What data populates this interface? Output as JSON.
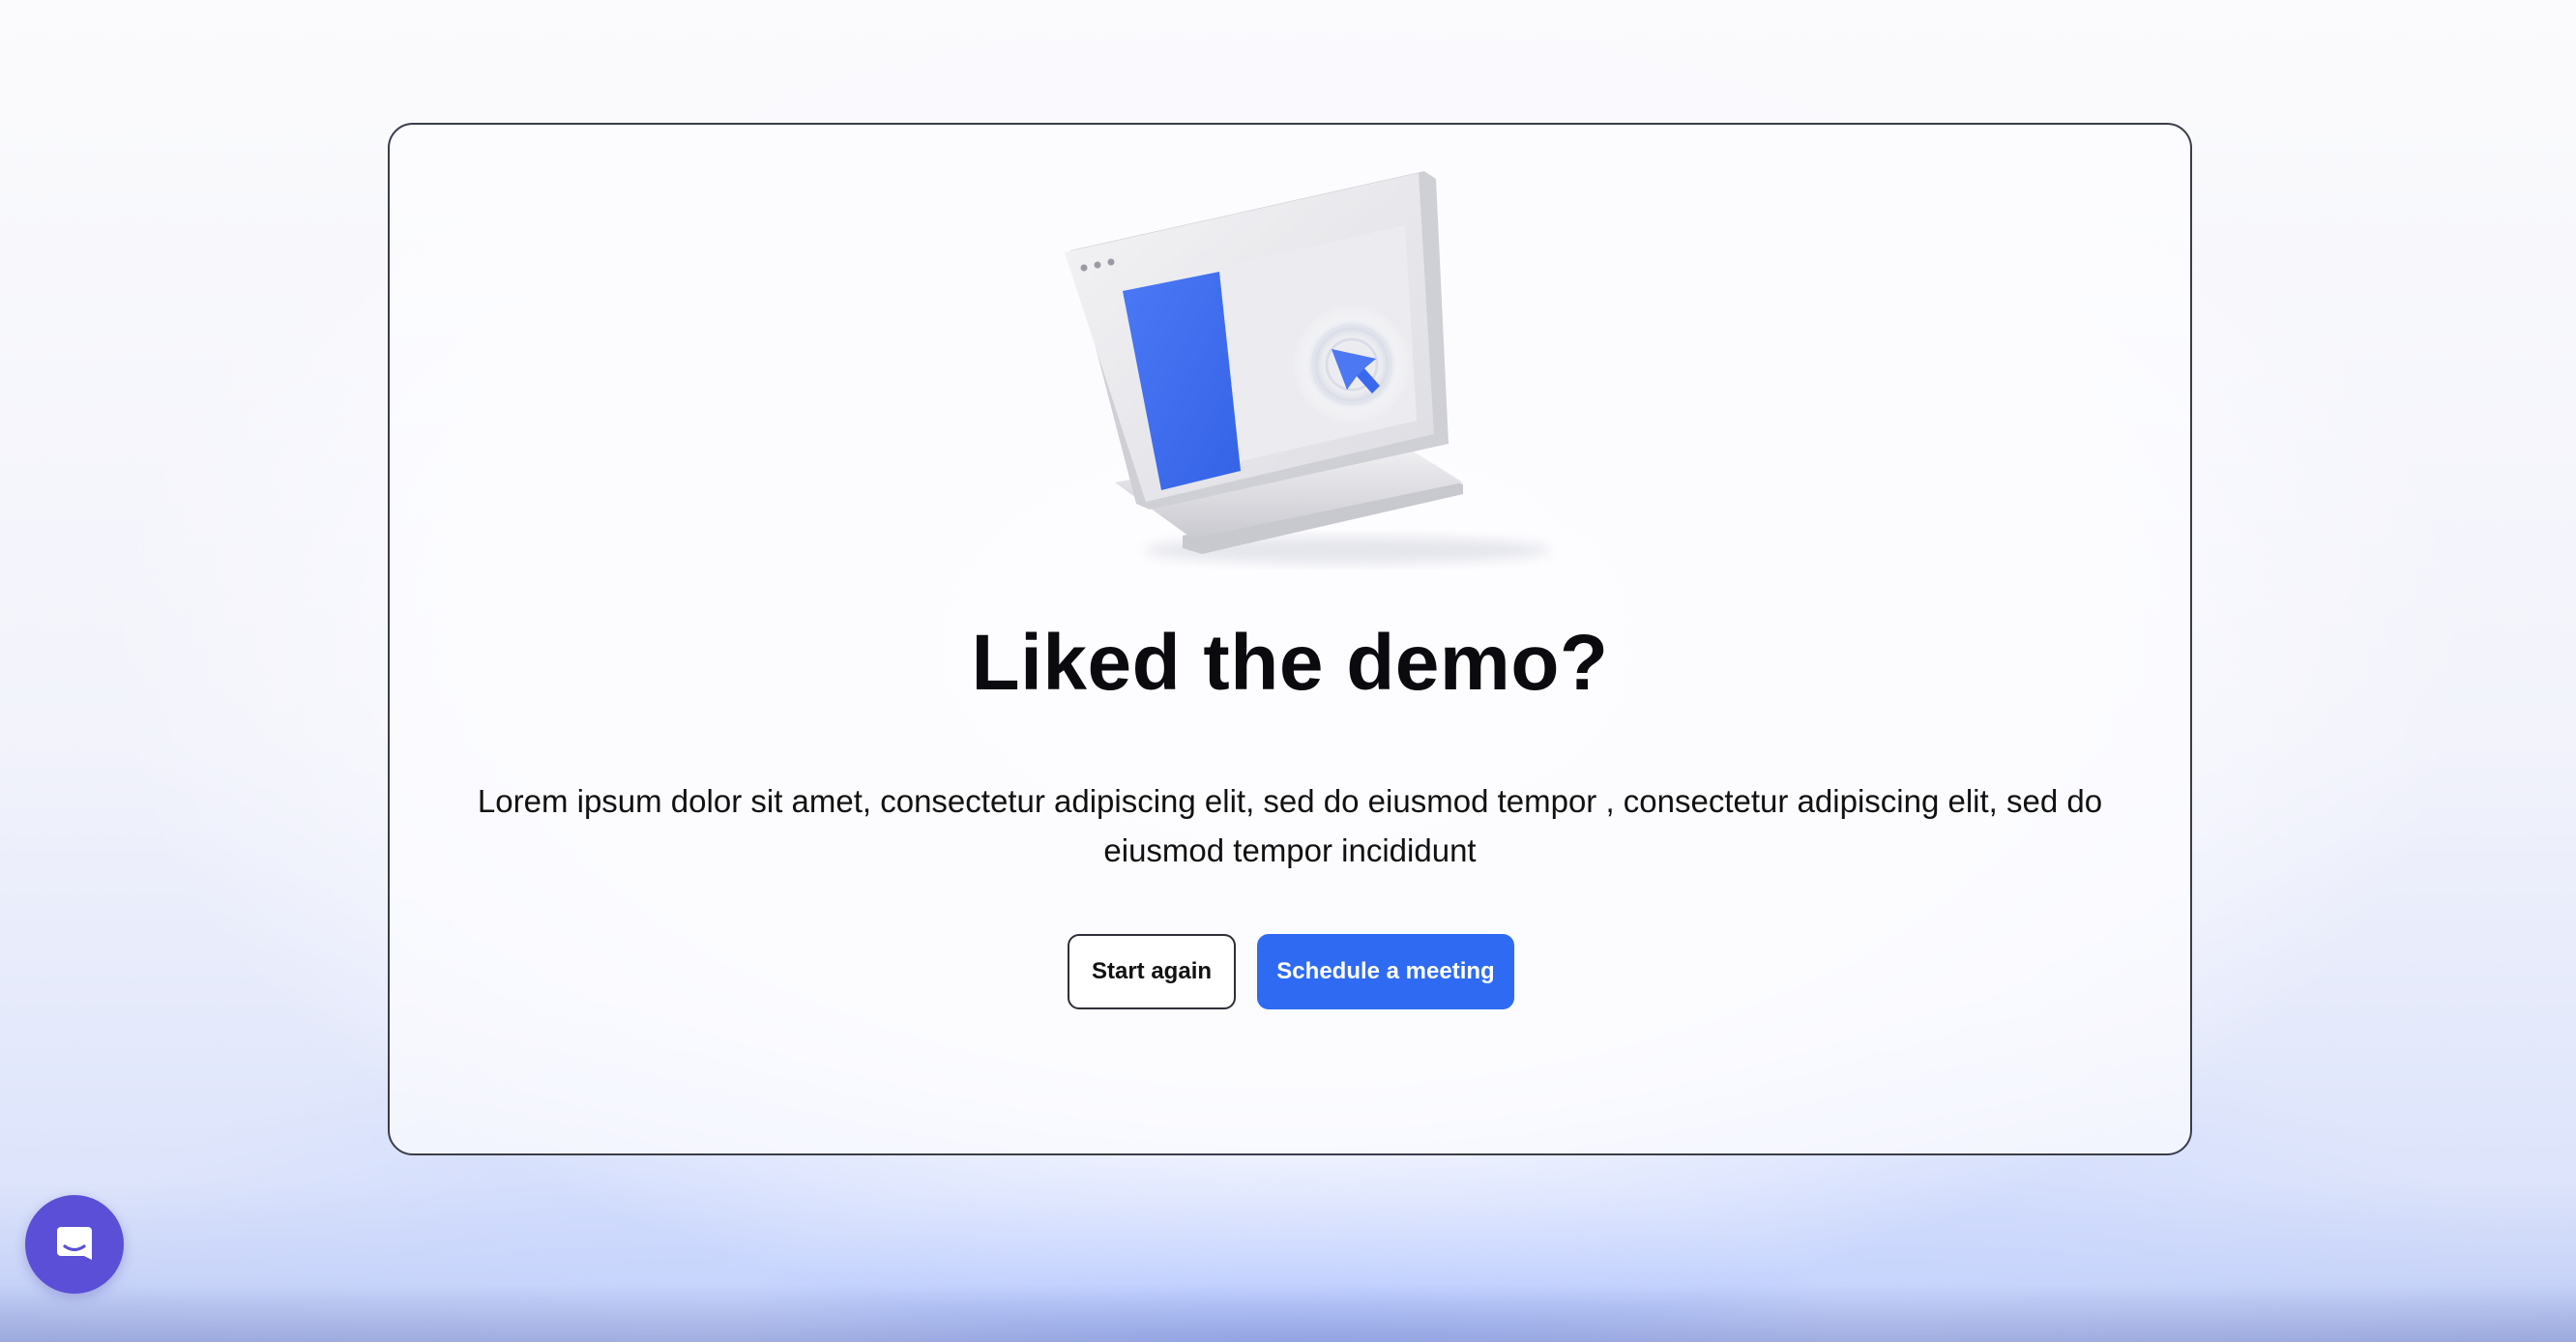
{
  "main": {
    "title": "Liked the demo?",
    "description": "Lorem ipsum dolor sit amet, consectetur adipiscing elit, sed do eiusmod tempor , consectetur adipiscing elit, sed do eiusmod tempor incididunt",
    "start_again_label": "Start again",
    "schedule_label": "Schedule a meeting"
  },
  "illustration": {
    "icon": "laptop-cursor-illustration"
  },
  "chat": {
    "icon": "chat-bubble-icon"
  },
  "colors": {
    "accent": "#2f6bf2",
    "chat_launcher": "#5a4fd6",
    "title_text": "#0b0b0f"
  }
}
